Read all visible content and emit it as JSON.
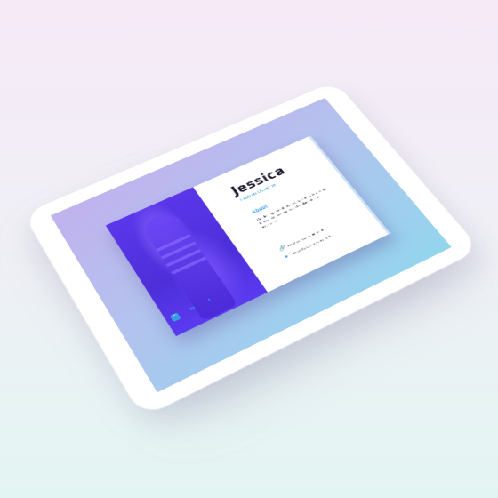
{
  "profile": {
    "name": "Jessica",
    "role": "Fashion Designer",
    "about_title": "About",
    "about_text": "Conducting market research to identify new trends, fabrics and techniques and seeking design inspiration.",
    "website": "www.jessicafashion.com",
    "location": "New York City, New York"
  },
  "social": {
    "icons": [
      "social-box-icon",
      "linkedin-icon",
      "twitter-icon"
    ],
    "linkedin_glyph": "in",
    "twitter_glyph": "t"
  },
  "colors": {
    "accent": "#3aa0ea",
    "photo_purple": "#5a37ea",
    "screen_top": "#c1b2ee",
    "screen_bottom": "#93d6ee"
  }
}
